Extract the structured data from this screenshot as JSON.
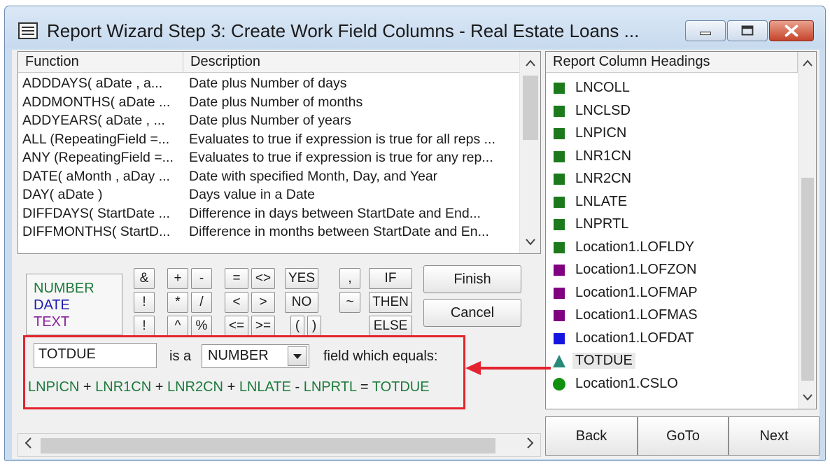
{
  "window": {
    "title": "Report Wizard Step 3:  Create Work Field Columns - Real Estate Loans ..."
  },
  "function_list": {
    "headers": {
      "function": "Function",
      "description": "Description"
    },
    "rows": [
      {
        "function": "ADDDAYS( aDate , a...",
        "description": "Date plus Number of days"
      },
      {
        "function": "ADDMONTHS( aDate ...",
        "description": "Date plus Number of months"
      },
      {
        "function": "ADDYEARS( aDate , ...",
        "description": "Date plus Number of years"
      },
      {
        "function": "ALL (RepeatingField =...",
        "description": "Evaluates to true if expression is true for all reps ..."
      },
      {
        "function": "ANY (RepeatingField =...",
        "description": "Evaluates to true if expression is true for any rep..."
      },
      {
        "function": "DATE( aMonth , aDay ...",
        "description": "Date with specified Month, Day, and Year"
      },
      {
        "function": "DAY( aDate )",
        "description": "Days value in a Date"
      },
      {
        "function": "DIFFDAYS( StartDate ...",
        "description": "Difference in days between StartDate and End..."
      },
      {
        "function": "DIFFMONTHS( StartD...",
        "description": "Difference in months between StartDate and En..."
      }
    ]
  },
  "type_legend": {
    "number": "NUMBER",
    "date": "DATE",
    "text": "TEXT",
    "colors": {
      "number": "#1c7a3c",
      "date": "#1b1bb0",
      "text": "#8a1fa0"
    }
  },
  "operators": {
    "amp": "&",
    "pipe": "!",
    "not": "!",
    "plus": "+",
    "times": "*",
    "caret": "^",
    "minus": "-",
    "divide": "/",
    "percent": "%",
    "eq": "=",
    "lt": "<",
    "le": "<=",
    "ne": "<>",
    "gt": ">",
    "ge": ">=",
    "yes": "YES",
    "no": "NO",
    "lparen": "(",
    "rparen": ")",
    "comma": ",",
    "tilde": "~",
    "if": "IF",
    "then": "THEN",
    "else": "ELSE"
  },
  "buttons": {
    "finish": "Finish",
    "cancel": "Cancel",
    "back": "Back",
    "goto": "GoTo",
    "next": "Next"
  },
  "field_definition": {
    "name_value": "TOTDUE",
    "is_a": "is a",
    "type_value": "NUMBER",
    "equals_label": "field which equals:"
  },
  "formula_tokens": [
    {
      "text": "LNPICN",
      "kind": "field"
    },
    {
      "text": " + ",
      "kind": "op"
    },
    {
      "text": "LNR1CN",
      "kind": "field"
    },
    {
      "text": " + ",
      "kind": "op"
    },
    {
      "text": "LNR2CN",
      "kind": "field"
    },
    {
      "text": " + ",
      "kind": "op"
    },
    {
      "text": "LNLATE",
      "kind": "field"
    },
    {
      "text": " - ",
      "kind": "op"
    },
    {
      "text": "LNPRTL",
      "kind": "field"
    },
    {
      "text": " = ",
      "kind": "op"
    },
    {
      "text": "TOTDUE",
      "kind": "field"
    }
  ],
  "report_columns": {
    "header": "Report Column Headings",
    "items": [
      {
        "label": "LNCOLL",
        "marker": "square",
        "color": "#1c7a1c"
      },
      {
        "label": "LNCLSD",
        "marker": "square",
        "color": "#1c7a1c"
      },
      {
        "label": "LNPICN",
        "marker": "square",
        "color": "#1c7a1c"
      },
      {
        "label": "LNR1CN",
        "marker": "square",
        "color": "#1c7a1c"
      },
      {
        "label": "LNR2CN",
        "marker": "square",
        "color": "#1c7a1c"
      },
      {
        "label": "LNLATE",
        "marker": "square",
        "color": "#1c7a1c"
      },
      {
        "label": "LNPRTL",
        "marker": "square",
        "color": "#1c7a1c"
      },
      {
        "label": "Location1.LOFLDY",
        "marker": "square",
        "color": "#1c7a1c"
      },
      {
        "label": "Location1.LOFZON",
        "marker": "square",
        "color": "#800080"
      },
      {
        "label": "Location1.LOFMAP",
        "marker": "square",
        "color": "#800080"
      },
      {
        "label": "Location1.LOFMAS",
        "marker": "square",
        "color": "#800080"
      },
      {
        "label": "Location1.LOFDAT",
        "marker": "square",
        "color": "#1515e0"
      },
      {
        "label": "TOTDUE",
        "marker": "triangle",
        "color": "#2a8a7a",
        "selected": true
      },
      {
        "label": "Location1.CSLO",
        "marker": "circle",
        "color": "#109010"
      }
    ]
  },
  "annotation": {
    "color": "#e3232e"
  },
  "icons": [
    "report-icon",
    "minimize-icon",
    "maximize-icon",
    "close-icon",
    "chevron-down-icon",
    "arrow-left-icon"
  ]
}
